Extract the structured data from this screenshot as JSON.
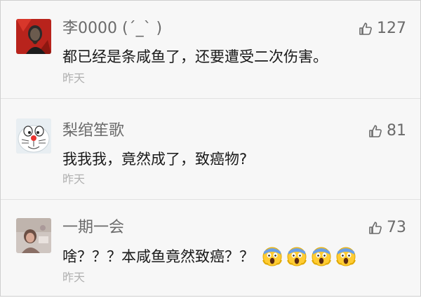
{
  "comments": [
    {
      "name": "李0000 (´_` )",
      "likes": "127",
      "text": "都已经是条咸鱼了，还要遭受二次伤害。",
      "time": "昨天",
      "avatar_icon": "lenin-portrait-avatar"
    },
    {
      "name": "梨绾笙歌",
      "likes": "81",
      "text": "我我我，竟然成了，致癌物?",
      "time": "昨天",
      "avatar_icon": "doraemon-avatar"
    },
    {
      "name": "一期一会",
      "likes": "73",
      "text": "啥？？？本咸鱼竟然致癌？？",
      "time": "昨天",
      "avatar_icon": "photo-avatar",
      "emojis": [
        "scream-emoji",
        "scream-emoji",
        "scream-emoji",
        "scream-emoji"
      ]
    }
  ],
  "colors": {
    "background": "#f7f7f7",
    "name": "#6b6b6b",
    "text": "#1a1a1a",
    "time": "#b0b0b0"
  }
}
